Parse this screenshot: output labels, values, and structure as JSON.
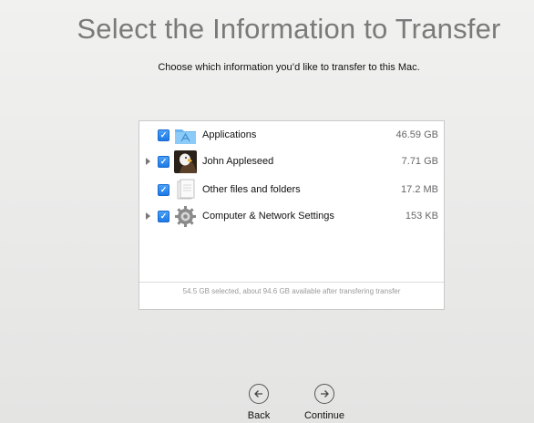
{
  "title": "Select the Information to Transfer",
  "subtitle": "Choose which information you’d like to transfer to this Mac.",
  "items": [
    {
      "label": "Applications",
      "size": "46.59 GB",
      "checked": true,
      "expandable": false,
      "icon": "applications-folder-icon"
    },
    {
      "label": "John Appleseed",
      "size": "7.71 GB",
      "checked": true,
      "expandable": true,
      "icon": "user-eagle-avatar-icon"
    },
    {
      "label": "Other files and folders",
      "size": "17.2 MB",
      "checked": true,
      "expandable": false,
      "icon": "documents-icon"
    },
    {
      "label": "Computer & Network Settings",
      "size": "153 KB",
      "checked": true,
      "expandable": true,
      "icon": "gear-icon"
    }
  ],
  "footer": "54.5 GB selected, about 94.6 GB available after transfering transfer",
  "buttons": {
    "back": "Back",
    "continue": "Continue"
  },
  "colors": {
    "checkbox": "#2a86ec",
    "title": "#7a7a7a",
    "folder": "#6bb6f2"
  }
}
